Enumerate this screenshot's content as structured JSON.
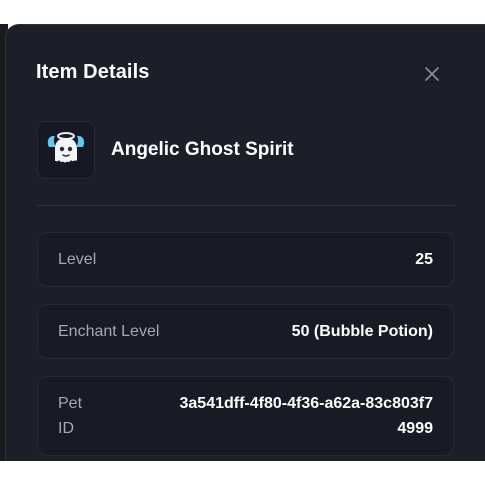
{
  "modal": {
    "title": "Item Details",
    "close_icon": "close-icon"
  },
  "item": {
    "name": "Angelic Ghost Spirit",
    "icon": "ghost-spirit-icon"
  },
  "details": [
    {
      "label": "Level",
      "value": "25"
    },
    {
      "label": "Enchant Level",
      "value": "50 (Bubble Potion)"
    },
    {
      "label": "Pet ID",
      "value": "3a541dff-4f80-4f36-a62a-83c803f74999"
    }
  ],
  "colors": {
    "modal_bg": "#1c1f28",
    "card_bg": "#181b24",
    "label": "#a3a8b3",
    "value": "#ffffff",
    "accent_glow": "#5ec8f2"
  }
}
